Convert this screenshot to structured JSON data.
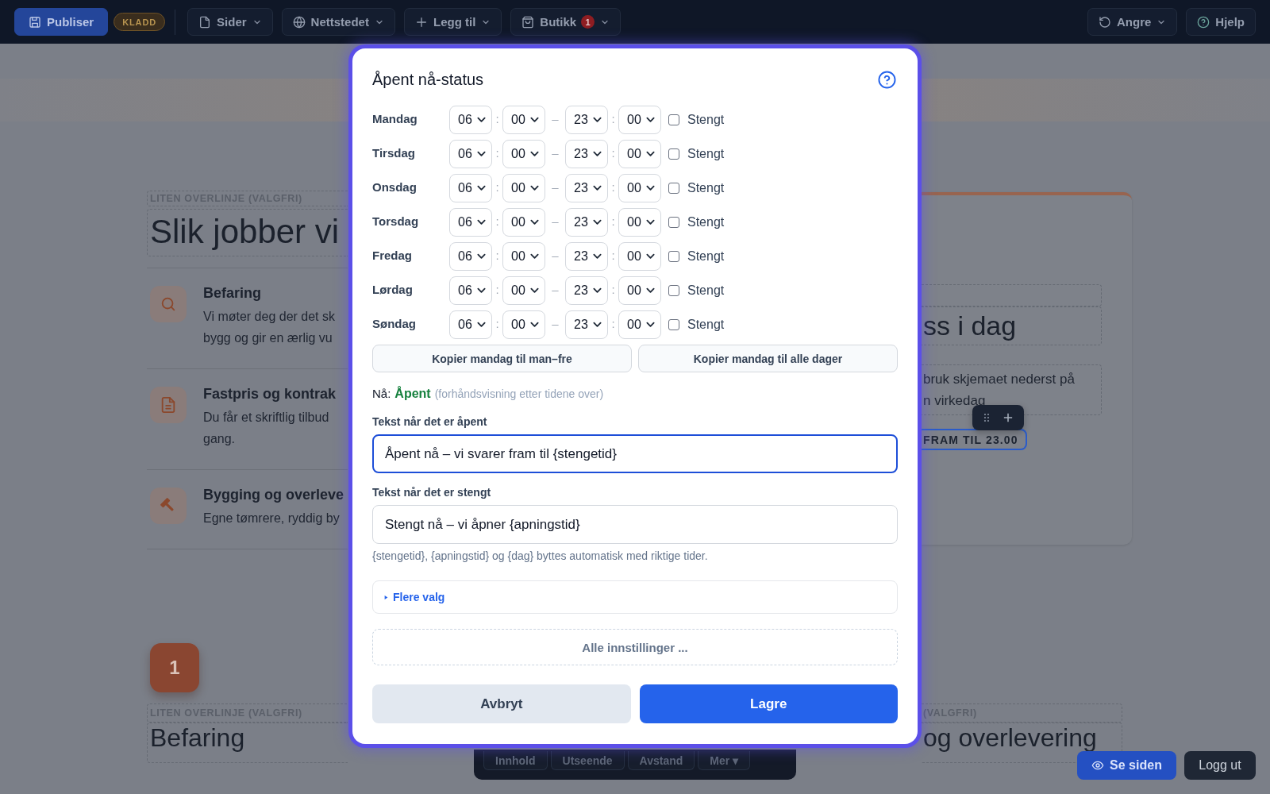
{
  "top_bar": {
    "publish_button": "Publiser",
    "status_badge": "KLADD",
    "menus": [
      {
        "label": "Sider"
      },
      {
        "label": "Nettstedet"
      },
      {
        "label": "Legg til"
      },
      {
        "label": "Butikk",
        "badge": "1"
      }
    ],
    "undo_button": "Angre",
    "help_button": "Hjelp"
  },
  "intro": {
    "overline": "LITEN OVERLINJE (VALGFRI)",
    "heading": "Slik jobber vi",
    "steps": [
      {
        "title": "Befaring",
        "lines": [
          "Vi møter deg der det sk",
          "bygg og gir en ærlig vu"
        ]
      },
      {
        "title": "Fastpris og kontrak",
        "lines": [
          "Du får et skriftlig tilbud",
          "gang."
        ]
      },
      {
        "title": "Bygging og overleve",
        "lines": [
          "Egne tømrere, ryddig by"
        ]
      }
    ]
  },
  "contact_card": {
    "heading": "ss i dag",
    "lines": [
      "bruk skjemaet nederst på",
      "n virkedag"
    ],
    "status_badge": "FRAM TIL 23.00"
  },
  "step_section": {
    "number": "1",
    "columns": [
      {
        "overline": "LITEN OVERLINJE (VALGFRI)",
        "heading": "Befaring"
      },
      {
        "overline": "(VALGFRI)",
        "heading": "og overlevering"
      }
    ]
  },
  "block_toolbar": {
    "tabs": [
      "Innhold",
      "Utseende",
      "Avstand",
      "Mer ▾"
    ]
  },
  "modal": {
    "title": "Åpent nå-status",
    "days": [
      {
        "name": "Mandag",
        "from": {
          "hour": "06",
          "sep": ":",
          "minute": "00"
        },
        "dash": "–",
        "to": {
          "hour": "23",
          "sep": ":",
          "minute": "00"
        },
        "closed": false,
        "closed_label": "Stengt"
      },
      {
        "name": "Tirsdag",
        "from": {
          "hour": "06",
          "sep": ":",
          "minute": "00"
        },
        "dash": "–",
        "to": {
          "hour": "23",
          "sep": ":",
          "minute": "00"
        },
        "closed": false,
        "closed_label": "Stengt"
      },
      {
        "name": "Onsdag",
        "from": {
          "hour": "06",
          "sep": ":",
          "minute": "00"
        },
        "dash": "–",
        "to": {
          "hour": "23",
          "sep": ":",
          "minute": "00"
        },
        "closed": false,
        "closed_label": "Stengt"
      },
      {
        "name": "Torsdag",
        "from": {
          "hour": "06",
          "sep": ":",
          "minute": "00"
        },
        "dash": "–",
        "to": {
          "hour": "23",
          "sep": ":",
          "minute": "00"
        },
        "closed": false,
        "closed_label": "Stengt"
      },
      {
        "name": "Fredag",
        "from": {
          "hour": "06",
          "sep": ":",
          "minute": "00"
        },
        "dash": "–",
        "to": {
          "hour": "23",
          "sep": ":",
          "minute": "00"
        },
        "closed": false,
        "closed_label": "Stengt"
      },
      {
        "name": "Lørdag",
        "from": {
          "hour": "06",
          "sep": ":",
          "minute": "00"
        },
        "dash": "–",
        "to": {
          "hour": "23",
          "sep": ":",
          "minute": "00"
        },
        "closed": false,
        "closed_label": "Stengt"
      },
      {
        "name": "Søndag",
        "from": {
          "hour": "06",
          "sep": ":",
          "minute": "00"
        },
        "dash": "–",
        "to": {
          "hour": "23",
          "sep": ":",
          "minute": "00"
        },
        "closed": false,
        "closed_label": "Stengt"
      }
    ],
    "copy_buttons": [
      "Kopier mandag til man–fre",
      "Kopier mandag til alle dager"
    ],
    "status": {
      "label": "Nå:",
      "value": "Åpent",
      "open": true,
      "note": "(forhåndsvisning etter tidene over)"
    },
    "open_text": {
      "label": "Tekst når det er åpent",
      "value": "Åpent nå – vi svarer fram til {stengetid}",
      "focused": true
    },
    "closed_text": {
      "label": "Tekst når det er stengt",
      "value": "Stengt nå – vi åpner {apningstid}",
      "focused": false
    },
    "hint": "{stengetid}, {apningstid} og {dag} byttes automatisk med riktige tider.",
    "more_options": {
      "label": "Flere valg",
      "expanded": false
    },
    "all_settings": "Alle innstillinger ...",
    "cancel_button": "Avbryt",
    "save_button": "Lagre"
  },
  "floating_buttons": {
    "view_page": "Se siden",
    "log_out": "Logg ut"
  }
}
